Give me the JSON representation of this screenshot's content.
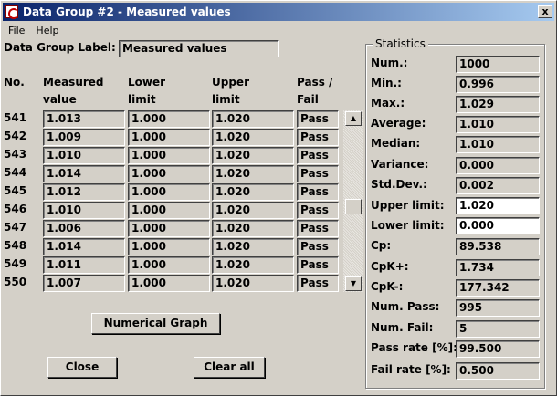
{
  "window": {
    "title": "Data Group #2 - Measured values",
    "close_glyph": "x"
  },
  "menu": {
    "items": [
      "File",
      "Help"
    ]
  },
  "group_label": {
    "label": "Data Group Label:",
    "value": "Measured values"
  },
  "table": {
    "headers": {
      "no": "No.",
      "measured_1": "Measured",
      "measured_2": "value",
      "lower_1": "Lower",
      "lower_2": "limit",
      "upper_1": "Upper",
      "upper_2": "limit",
      "pass_1": "Pass /",
      "pass_2": "Fail"
    },
    "rows": [
      {
        "no": "541",
        "measured": "1.013",
        "lower": "1.000",
        "upper": "1.020",
        "pass": "Pass"
      },
      {
        "no": "542",
        "measured": "1.009",
        "lower": "1.000",
        "upper": "1.020",
        "pass": "Pass"
      },
      {
        "no": "543",
        "measured": "1.010",
        "lower": "1.000",
        "upper": "1.020",
        "pass": "Pass"
      },
      {
        "no": "544",
        "measured": "1.014",
        "lower": "1.000",
        "upper": "1.020",
        "pass": "Pass"
      },
      {
        "no": "545",
        "measured": "1.012",
        "lower": "1.000",
        "upper": "1.020",
        "pass": "Pass"
      },
      {
        "no": "546",
        "measured": "1.010",
        "lower": "1.000",
        "upper": "1.020",
        "pass": "Pass"
      },
      {
        "no": "547",
        "measured": "1.006",
        "lower": "1.000",
        "upper": "1.020",
        "pass": "Pass"
      },
      {
        "no": "548",
        "measured": "1.014",
        "lower": "1.000",
        "upper": "1.020",
        "pass": "Pass"
      },
      {
        "no": "549",
        "measured": "1.011",
        "lower": "1.000",
        "upper": "1.020",
        "pass": "Pass"
      },
      {
        "no": "550",
        "measured": "1.007",
        "lower": "1.000",
        "upper": "1.020",
        "pass": "Pass"
      }
    ]
  },
  "buttons": {
    "graph": "Numerical Graph",
    "close": "Close",
    "clear": "Clear all"
  },
  "statistics": {
    "title": "Statistics",
    "items": [
      {
        "label": "Num.:",
        "value": "1000",
        "editable": false
      },
      {
        "label": "Min.:",
        "value": "0.996",
        "editable": false
      },
      {
        "label": "Max.:",
        "value": "1.029",
        "editable": false
      },
      {
        "label": "Average:",
        "value": "1.010",
        "editable": false
      },
      {
        "label": "Median:",
        "value": "1.010",
        "editable": false
      },
      {
        "label": "Variance:",
        "value": "0.000",
        "editable": false
      },
      {
        "label": "Std.Dev.:",
        "value": "0.002",
        "editable": false
      },
      {
        "label": "Upper limit:",
        "value": "1.020",
        "editable": true
      },
      {
        "label": "Lower limit:",
        "value": "0.000",
        "editable": true
      },
      {
        "label": "Cp:",
        "value": "89.538",
        "editable": false
      },
      {
        "label": "CpK+:",
        "value": "1.734",
        "editable": false
      },
      {
        "label": "CpK-:",
        "value": "177.342",
        "editable": false
      },
      {
        "label": "Num. Pass:",
        "value": "995",
        "editable": false
      },
      {
        "label": "Num. Fail:",
        "value": "5",
        "editable": false
      },
      {
        "label": "Pass rate [%]:",
        "value": "99.500",
        "editable": false
      },
      {
        "label": "Fail rate [%]:",
        "value": "0.500",
        "editable": false
      }
    ]
  },
  "icons": {
    "scroll_up": "▲",
    "scroll_down": "▼"
  }
}
